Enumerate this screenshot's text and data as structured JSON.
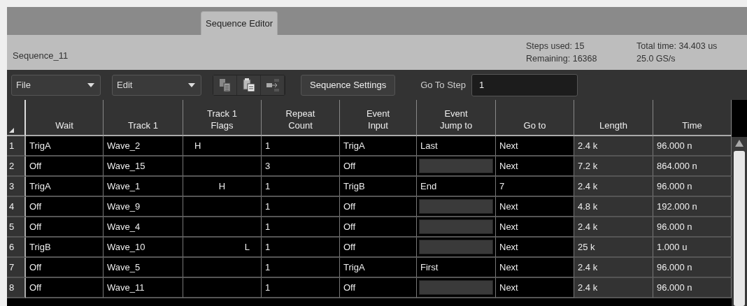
{
  "tabs": [
    {
      "label": "Sequence Editor",
      "selected": true
    }
  ],
  "sequence_name": "Sequence_11",
  "stats": [
    {
      "line_1": "Steps used: 15",
      "line_2": "Remaining: 16368"
    },
    {
      "line_1": "Total time: 34.403 us",
      "line_2": "25.0 GS/s"
    }
  ],
  "toolbar": {
    "menus": [
      "File",
      "Edit"
    ],
    "settings_button": "Sequence Settings",
    "goto_label": "Go To Step",
    "goto_value": "1"
  },
  "table": {
    "columns": [
      {
        "label": "Wait",
        "readonly": false
      },
      {
        "label": "Track 1",
        "readonly": false
      },
      {
        "label": "Track 1\nFlags",
        "readonly": false
      },
      {
        "label": "Repeat\nCount",
        "readonly": false
      },
      {
        "label": "Event\nInput",
        "readonly": false
      },
      {
        "label": "Event\nJump to",
        "readonly": false
      },
      {
        "label": "Go to",
        "readonly": false
      },
      {
        "label": "Length",
        "readonly": true
      },
      {
        "label": "Time",
        "readonly": true
      }
    ],
    "rows": [
      {
        "index": "1",
        "wait": "TrigA",
        "track": "Wave_2",
        "flag": {
          "text": "H",
          "kind": "left"
        },
        "repeat": "1",
        "event_input": "TrigA",
        "jump_to": "Last",
        "jump_enabled": true,
        "go_to": "Next",
        "length": "2.4 k",
        "time": "96.000 n"
      },
      {
        "index": "2",
        "wait": "Off",
        "track": "Wave_15",
        "repeat": "3",
        "event_input": "Off",
        "jump_enabled": false,
        "go_to": "Next",
        "length": "7.2 k",
        "time": "864.000 n"
      },
      {
        "index": "3",
        "wait": "TrigA",
        "track": "Wave_1",
        "flag": {
          "text": "H",
          "kind": "center"
        },
        "repeat": "1",
        "event_input": "TrigB",
        "jump_to": "End",
        "jump_enabled": true,
        "go_to": "7",
        "length": "2.4 k",
        "time": "96.000 n"
      },
      {
        "index": "4",
        "wait": "Off",
        "track": "Wave_9",
        "repeat": "1",
        "event_input": "Off",
        "jump_enabled": false,
        "go_to": "Next",
        "length": "4.8 k",
        "time": "192.000 n"
      },
      {
        "index": "5",
        "wait": "Off",
        "track": "Wave_4",
        "repeat": "1",
        "event_input": "Off",
        "jump_enabled": false,
        "go_to": "Next",
        "length": "2.4 k",
        "time": "96.000 n"
      },
      {
        "index": "6",
        "wait": "TrigB",
        "track": "Wave_10",
        "flag": {
          "text": "L",
          "kind": "right"
        },
        "repeat": "1",
        "event_input": "Off",
        "jump_enabled": false,
        "go_to": "Next",
        "length": "25 k",
        "time": "1.000 u"
      },
      {
        "index": "7",
        "wait": "Off",
        "track": "Wave_5",
        "repeat": "1",
        "event_input": "TrigA",
        "jump_to": "First",
        "jump_enabled": true,
        "go_to": "Next",
        "length": "2.4 k",
        "time": "96.000 n"
      },
      {
        "index": "8",
        "wait": "Off",
        "track": "Wave_11",
        "repeat": "1",
        "event_input": "Off",
        "jump_enabled": false,
        "go_to": "Next",
        "length": "2.4 k",
        "time": "96.000 n"
      }
    ]
  }
}
